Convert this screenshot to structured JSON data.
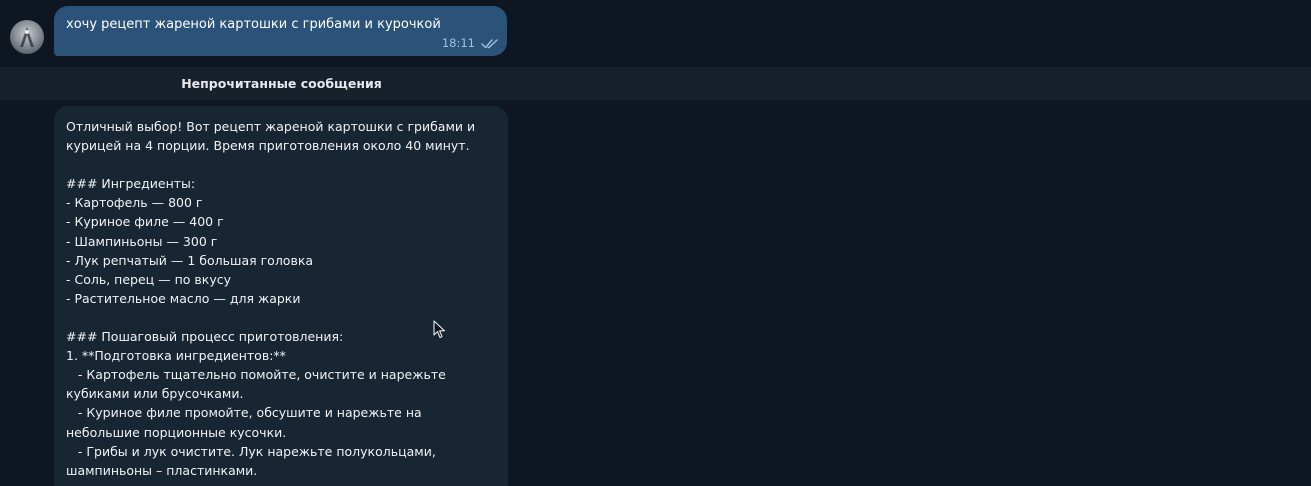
{
  "outgoing": {
    "text": "хочу рецепт жареной картошки с грибами и курочкой",
    "time": "18:11",
    "status_icon": "double-check-icon"
  },
  "unread_divider": {
    "label": "Непрочитанные сообщения"
  },
  "incoming": {
    "lines": [
      "Отличный выбор! Вот рецепт жареной картошки с грибами и",
      "курицей на 4 порции. Время приготовления около 40 минут.",
      "",
      "### Ингредиенты:",
      "- Картофель — 800 г",
      "- Куриное филе — 400 г",
      "- Шампиньоны — 300 г",
      "- Лук репчатый — 1 большая головка",
      "- Соль, перец — по вкусу",
      "- Растительное масло — для жарки",
      "",
      "### Пошаговый процесс приготовления:",
      "1. **Подготовка ингредиентов:**",
      "   - Картофель тщательно помойте, очистите и нарежьте",
      "кубиками или брусочками.",
      "   - Куриное филе промойте, обсушите и нарежьте на",
      "небольшие порционные кусочки.",
      "   - Грибы и лук очистите. Лук нарежьте полукольцами,",
      "шампиньоны – пластинками."
    ]
  },
  "colors": {
    "background": "#0e1621",
    "outgoing_bubble": "#2b5278",
    "incoming_bubble": "#182533",
    "divider_bar": "#17212b"
  }
}
